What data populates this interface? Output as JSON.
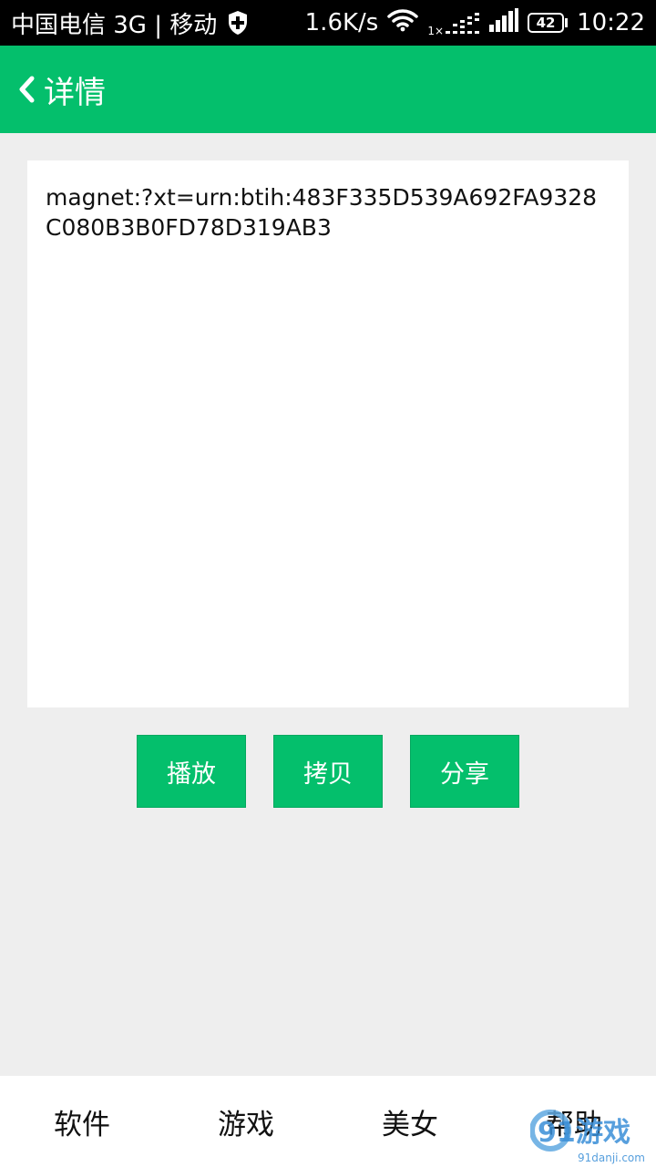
{
  "status_bar": {
    "carrier": "中国电信 3G | 移动",
    "speed": "1.6K/s",
    "signal_label": "1×",
    "battery_level": "42",
    "time": "10:22",
    "icons": [
      "shield-icon",
      "wifi-icon",
      "data-signal-icon",
      "cell-signal-icon",
      "battery-icon"
    ]
  },
  "app_bar": {
    "title": "详情",
    "back_icon": "chevron-left-icon",
    "color": "#04bf6c"
  },
  "detail": {
    "link_text": "magnet:?xt=urn:btih:483F335D539A692FA9328C080B3B0FD78D319AB3"
  },
  "actions": {
    "play_label": "播放",
    "copy_label": "拷贝",
    "share_label": "分享"
  },
  "bottom_nav": {
    "items": [
      "软件",
      "游戏",
      "美女",
      "帮助"
    ]
  },
  "watermark": {
    "logo_text": "91游戏",
    "site_text": "91danji.com"
  }
}
